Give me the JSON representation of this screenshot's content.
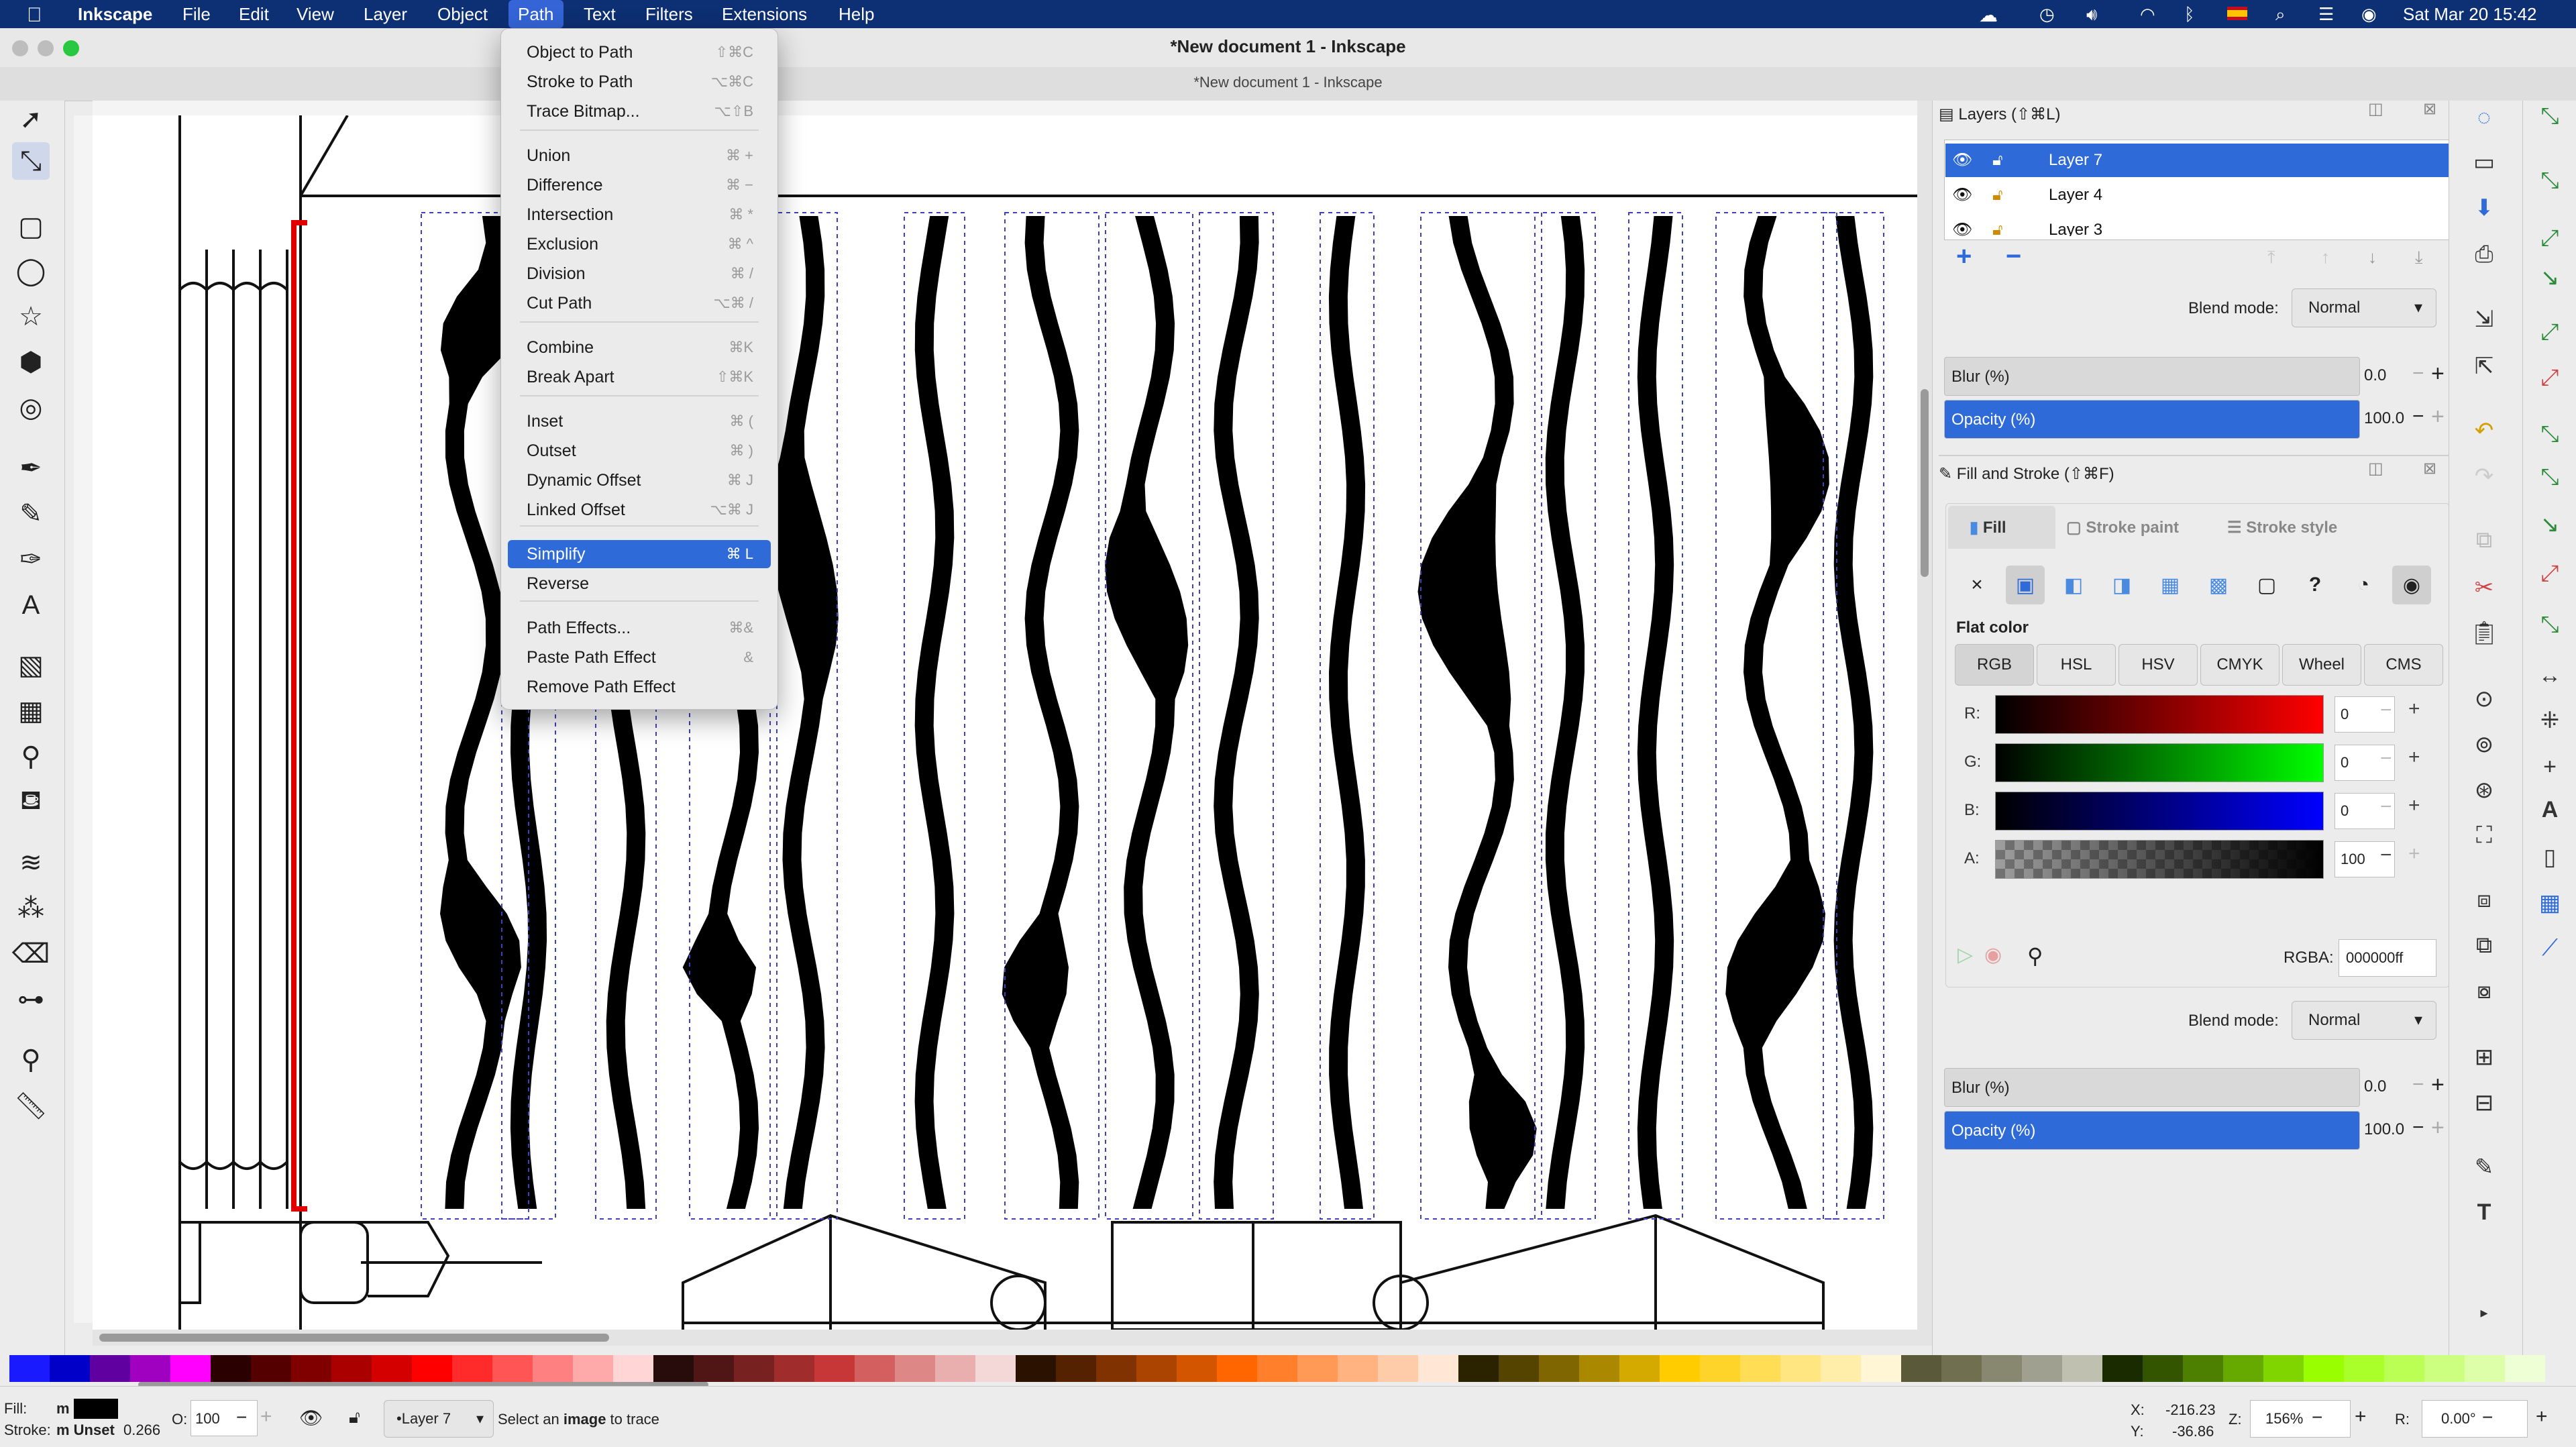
{
  "menubar": {
    "app_name": "Inkscape",
    "items": [
      "File",
      "Edit",
      "View",
      "Layer",
      "Object",
      "Path",
      "Text",
      "Filters",
      "Extensions",
      "Help"
    ],
    "active_item": "Path",
    "clock": "Sat Mar 20  15:42",
    "icons": [
      "apple-icon",
      "cloud-icon",
      "clock-icon",
      "volume-icon",
      "wifi-icon",
      "bluetooth-icon",
      "flag-icon",
      "search-icon",
      "control-center-icon",
      "siri-icon"
    ]
  },
  "window": {
    "title": "*New document 1 - Inkscape",
    "tab_title": "*New document 1 - Inkscape"
  },
  "path_menu": {
    "items": [
      {
        "label": "Object to Path",
        "shortcut": "⇧⌘C"
      },
      {
        "label": "Stroke to Path",
        "shortcut": "⌥⌘C"
      },
      {
        "label": "Trace Bitmap...",
        "shortcut": "⌥⇧B"
      },
      {
        "label": "Union",
        "shortcut": "⌘ +"
      },
      {
        "label": "Difference",
        "shortcut": "⌘ −"
      },
      {
        "label": "Intersection",
        "shortcut": "⌘ *"
      },
      {
        "label": "Exclusion",
        "shortcut": "⌘ ^"
      },
      {
        "label": "Division",
        "shortcut": "⌘ /"
      },
      {
        "label": "Cut Path",
        "shortcut": "⌥⌘ /"
      },
      {
        "label": "Combine",
        "shortcut": "⌘K"
      },
      {
        "label": "Break Apart",
        "shortcut": "⇧⌘K"
      },
      {
        "label": "Inset",
        "shortcut": "⌘ ("
      },
      {
        "label": "Outset",
        "shortcut": "⌘ )"
      },
      {
        "label": "Dynamic Offset",
        "shortcut": "⌘ J"
      },
      {
        "label": "Linked Offset",
        "shortcut": "⌥⌘ J"
      },
      {
        "label": "Simplify",
        "shortcut": "⌘ L"
      },
      {
        "label": "Reverse",
        "shortcut": ""
      },
      {
        "label": "Path Effects...",
        "shortcut": "⌘&"
      },
      {
        "label": "Paste Path Effect",
        "shortcut": "&"
      },
      {
        "label": "Remove Path Effect",
        "shortcut": ""
      }
    ],
    "highlighted": "Simplify"
  },
  "layers_panel": {
    "title": "Layers (⇧⌘L)",
    "layers": [
      {
        "name": "Layer 7",
        "selected": true
      },
      {
        "name": "Layer 4",
        "selected": false
      },
      {
        "name": "Layer 3",
        "selected": false
      }
    ],
    "blend_label": "Blend mode:",
    "blend_value": "Normal",
    "blur_label": "Blur (%)",
    "blur_value": "0.0",
    "opacity_label": "Opacity (%)",
    "opacity_value": "100.0"
  },
  "fill_stroke_panel": {
    "title": "Fill and Stroke (⇧⌘F)",
    "tabs": [
      "Fill",
      "Stroke paint",
      "Stroke style"
    ],
    "active_tab": "Fill",
    "paint_types": [
      "×",
      "▣",
      "◧",
      "◨",
      "▦",
      "▩",
      "▢",
      "?",
      "◔",
      "◉"
    ],
    "flat_color_label": "Flat color",
    "color_modes": [
      "RGB",
      "HSL",
      "HSV",
      "CMYK",
      "Wheel",
      "CMS"
    ],
    "active_mode": "RGB",
    "channels": [
      {
        "label": "R:",
        "value": "0"
      },
      {
        "label": "G:",
        "value": "0"
      },
      {
        "label": "B:",
        "value": "0"
      },
      {
        "label": "A:",
        "value": "100"
      }
    ],
    "rgba_label": "RGBA:",
    "rgba_value": "000000ff",
    "blend_label": "Blend mode:",
    "blend_value": "Normal",
    "blur_label": "Blur (%)",
    "blur_value": "0.0",
    "opacity_label": "Opacity (%)",
    "opacity_value": "100.0"
  },
  "palette_colors": [
    "#1a1aff",
    "#0000c8",
    "#6000a0",
    "#a000c0",
    "#ff00ff",
    "#2a0000",
    "#550000",
    "#800000",
    "#aa0000",
    "#d40000",
    "#ff0000",
    "#ff2a2a",
    "#ff5555",
    "#ff8080",
    "#ffaaaa",
    "#ffd5d5",
    "#280b0b",
    "#501616",
    "#782121",
    "#a02c2c",
    "#c83737",
    "#d35f5f",
    "#de8787",
    "#e9afaf",
    "#f4d7d7",
    "#2b1100",
    "#552200",
    "#803300",
    "#aa4400",
    "#d45500",
    "#ff6600",
    "#ff7f2a",
    "#ff9955",
    "#ffb380",
    "#ffccaa",
    "#ffe6d5",
    "#2b2200",
    "#554400",
    "#806600",
    "#aa8800",
    "#d4aa00",
    "#ffcc00",
    "#ffd42a",
    "#ffdd55",
    "#ffe680",
    "#ffeeaa",
    "#fff6d5",
    "#5a5a3a",
    "#707050",
    "#888870",
    "#a0a090",
    "#c0c0b0",
    "#1a2b00",
    "#335500",
    "#4d8000",
    "#66aa00",
    "#80d400",
    "#99ff00",
    "#aaff2a",
    "#bbff55",
    "#ccff80",
    "#ddffaa",
    "#eeffd5"
  ],
  "status": {
    "fill_label": "Fill:",
    "fill_value": "m",
    "stroke_label": "Stroke:",
    "stroke_value": "m Unset",
    "stroke_width": "0.266",
    "opacity_label": "O:",
    "opacity_value": "100",
    "layer_value": "•Layer 7",
    "message_pre": "Select an ",
    "message_bold": "image",
    "message_post": " to trace",
    "x_label": "X:",
    "x_value": "-216.23",
    "y_label": "Y:",
    "y_value": "-36.86",
    "z_label": "Z:",
    "zoom_value": "156%",
    "r_label": "R:",
    "rotation_value": "0.00°"
  }
}
